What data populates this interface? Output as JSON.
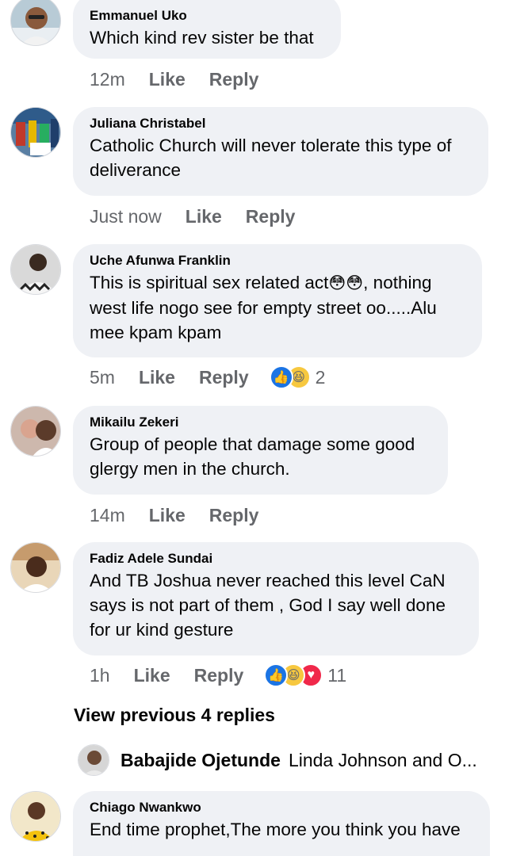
{
  "comments": [
    {
      "author": "Emmanuel Uko",
      "lines": [
        "Which kind rev sister be that"
      ],
      "time": "12m",
      "like": "Like",
      "reply": "Reply",
      "avatar_icon": "person-avatar"
    },
    {
      "author": "Juliana Christabel",
      "lines": [
        "Catholic Church will never tolerate this type of",
        "deliverance"
      ],
      "time": "Just now",
      "like": "Like",
      "reply": "Reply",
      "avatar_icon": "photo-avatar"
    },
    {
      "author": "Uche Afunwa Franklin",
      "line1_text": "This is spiritual sex related act",
      "line1_emoji": "😳😳",
      "line1_after": ", nothing",
      "lines": [
        "west life nogo see for empty street oo.....Alu",
        "mee kpam kpam"
      ],
      "time": "5m",
      "like": "Like",
      "reply": "Reply",
      "reactions": [
        "like",
        "haha"
      ],
      "reaction_count": "2",
      "avatar_icon": "person-avatar"
    },
    {
      "author": "Mikailu Zekeri",
      "lines": [
        "Group of people that damage some good",
        "glergy men in the church."
      ],
      "time": "14m",
      "like": "Like",
      "reply": "Reply",
      "avatar_icon": "person-avatar"
    },
    {
      "author": "Fadiz Adele Sundai",
      "lines": [
        "And TB Joshua never reached this level CaN",
        "says is not part of them , God I say well done",
        "for ur kind gesture"
      ],
      "time": "1h",
      "like": "Like",
      "reply": "Reply",
      "reactions": [
        "like",
        "haha",
        "love"
      ],
      "reaction_count": "11",
      "avatar_icon": "person-avatar"
    },
    {
      "author": "Chiago Nwankwo",
      "lines": [
        "End time prophet,The more you think you have"
      ],
      "avatar_icon": "person-avatar"
    }
  ],
  "view_previous": "View previous 4 replies",
  "reply_preview": {
    "name": "Babajide Ojetunde",
    "snippet": "Linda Johnson and O..."
  },
  "colors": {
    "bubble": "#eff1f5",
    "meta": "#65676b",
    "like_blue": "#1b74e4",
    "haha_yellow": "#f7c83f",
    "love_red": "#f0284a"
  }
}
